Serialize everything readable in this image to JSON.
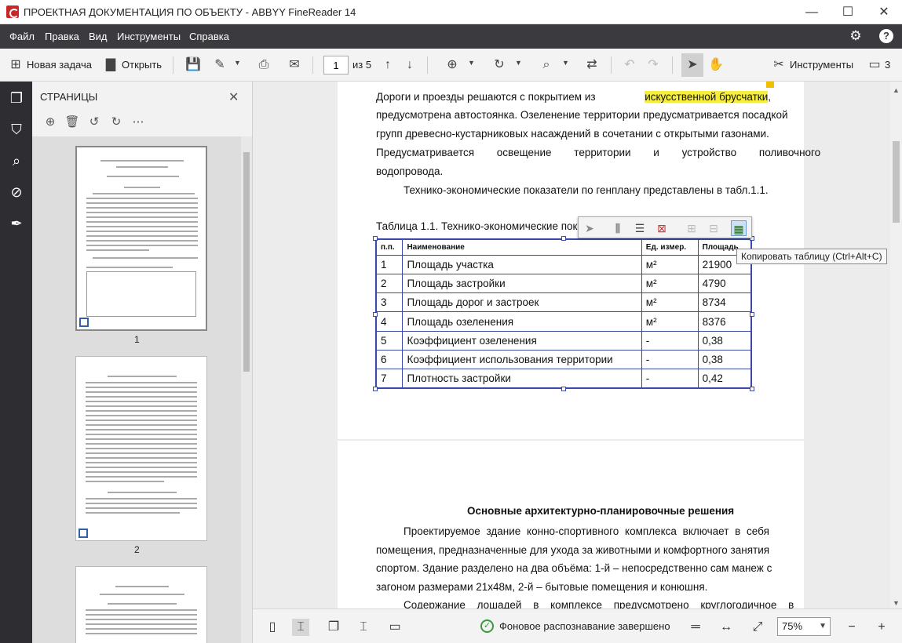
{
  "window": {
    "title": "ПРОЕКТНАЯ ДОКУМЕНТАЦИЯ ПО ОБЪЕКТУ - ABBYY FineReader 14",
    "minimize": "—",
    "maximize": "☐",
    "close": "✕"
  },
  "menu": {
    "items": [
      "Файл",
      "Правка",
      "Вид",
      "Инструменты",
      "Справка"
    ]
  },
  "toolbar": {
    "new_task": "Новая задача",
    "open": "Открыть",
    "page_current": "1",
    "page_of": "из 5",
    "tools": "Инструменты",
    "comments_count": "3"
  },
  "pages_panel": {
    "title": "СТРАНИЦЫ",
    "page_numbers": [
      "1",
      "2"
    ]
  },
  "document": {
    "para1_line0": "Дороги и проезды решаются с покрытием из",
    "para1_highlight": "искусственной брусчатки",
    "para1_line1": "предусмотрена автостоянка. Озеленение территории предусматривается посадкой",
    "para1_line2": "групп древесно-кустарниковых насаждений в сочетании с открытыми газонами.",
    "para1_line3": "Предусматривается освещение территории и устройство поливочного",
    "para1_line4": "водопровода.",
    "para2": "Технико-экономические показатели по генплану представлены в табл.1.1.",
    "table_caption": "Таблица 1.1. Технико-экономические пока",
    "table_headers": [
      "п.п.",
      "Наименование",
      "Ед. измер.",
      "Площадь"
    ],
    "table_rows": [
      [
        "1",
        "Площадь участка",
        "м²",
        "21900"
      ],
      [
        "2",
        "Площадь застройки",
        "м²",
        "4790"
      ],
      [
        "3",
        "Площадь дорог и застроек",
        "м²",
        "8734"
      ],
      [
        "4",
        "Площадь озеленения",
        "м²",
        "8376"
      ],
      [
        "5",
        "Коэффициент озеленения",
        "-",
        "0,38"
      ],
      [
        "6",
        "Коэффициент использования территории",
        "-",
        "0,38"
      ],
      [
        "7",
        "Плотность застройки",
        "-",
        "0,42"
      ]
    ],
    "page2_heading": "Основные архитектурно-планировочные решения",
    "page2_p1_l0": "Проектируемое здание конно-спортивного комплекса включает в себя",
    "page2_p1_l1": "помещения, предназначенные для ухода за животными и комфортного занятия",
    "page2_p1_l2": "спортом. Здание разделено на два объёма: 1-й – непосредственно сам манеж с",
    "page2_p1_l3": "загоном размерами 21х48м, 2-й – бытовые помещения и конюшня.",
    "page2_p2_l0": "Содержание лошадей в комплексе предусмотрено круглогодичное в"
  },
  "tooltip": "Копировать таблицу (Ctrl+Alt+C)",
  "status": {
    "text": "Фоновое распознавание завершено",
    "zoom": "75%"
  }
}
